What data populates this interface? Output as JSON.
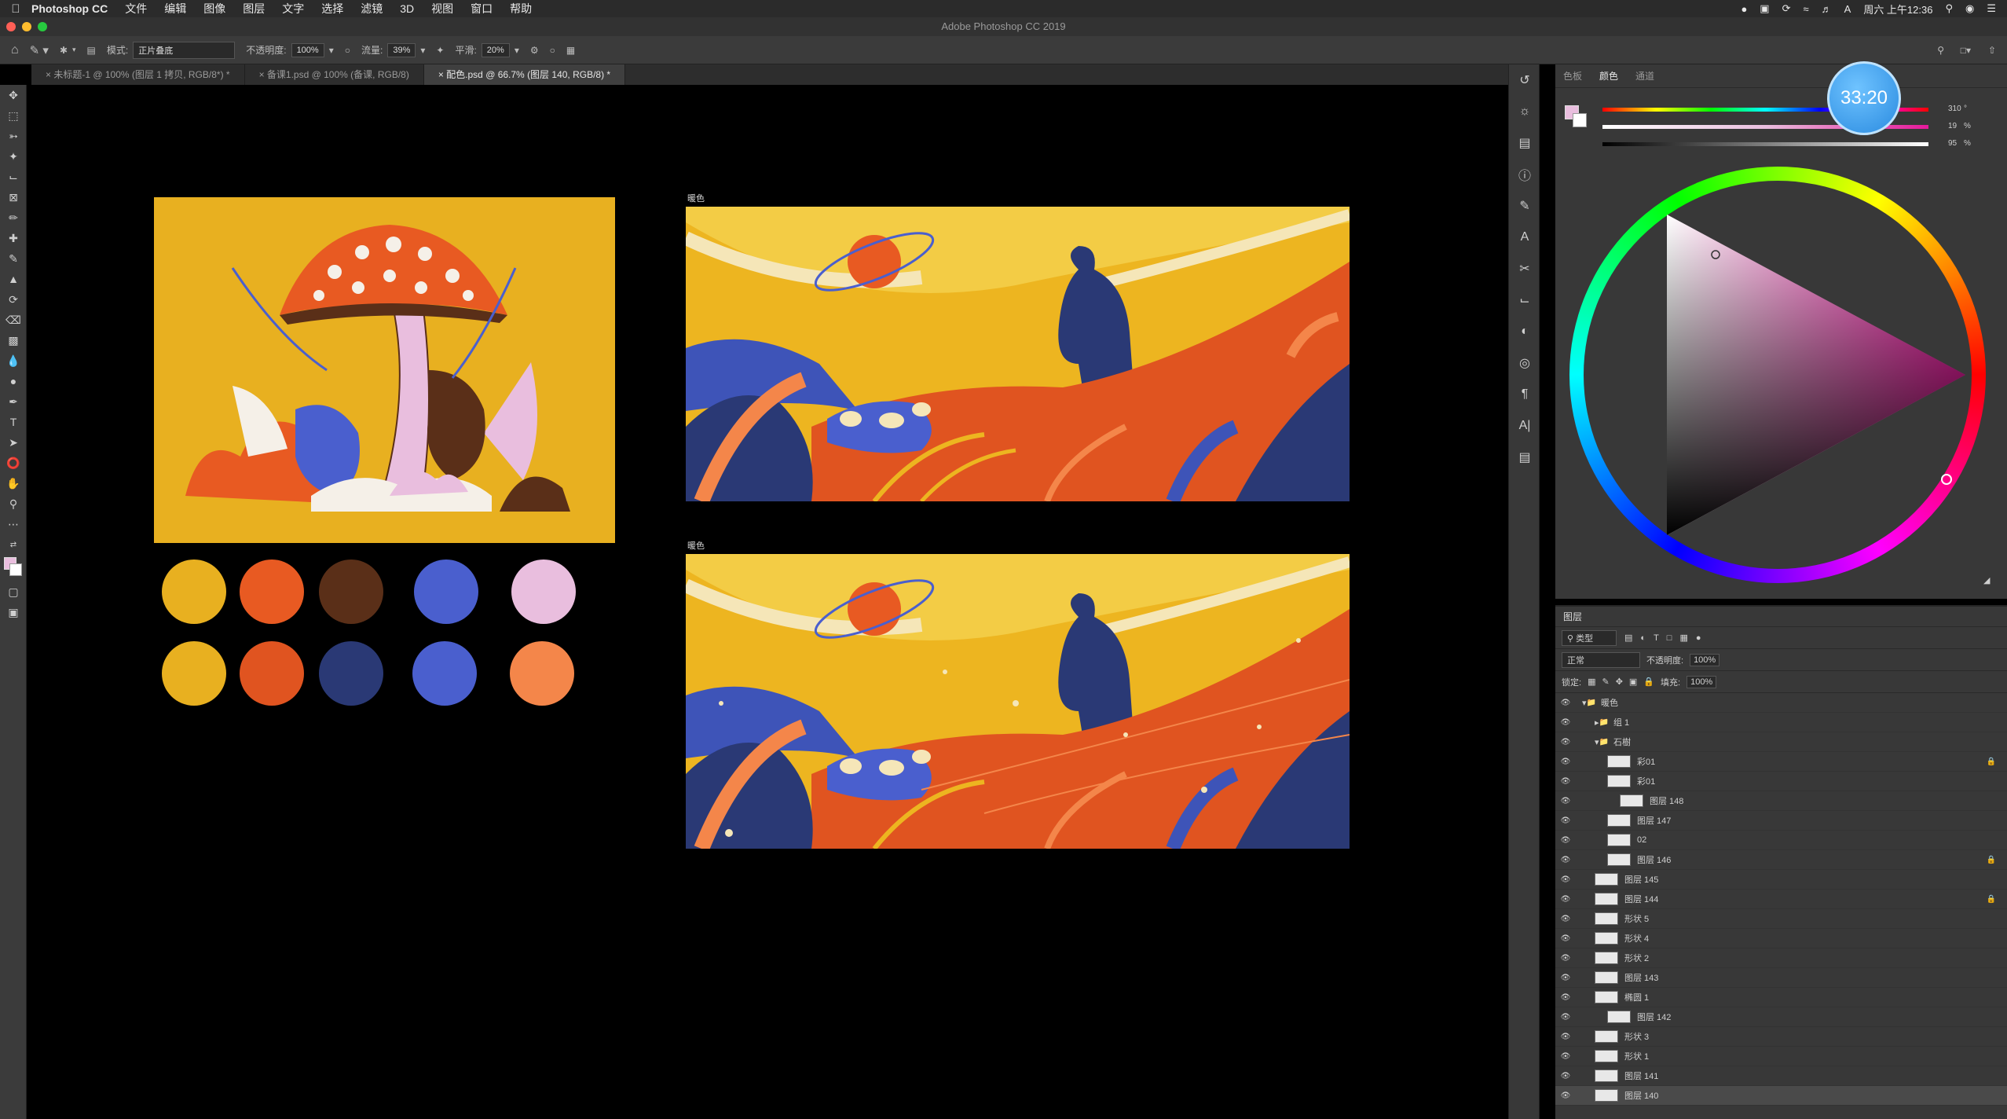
{
  "menubar": {
    "app_name": "Photoshop CC",
    "items": [
      "文件",
      "编辑",
      "图像",
      "图层",
      "文字",
      "选择",
      "滤镜",
      "3D",
      "视图",
      "窗口",
      "帮助"
    ],
    "clock": "周六 上午12:36"
  },
  "window": {
    "title": "Adobe Photoshop CC 2019"
  },
  "options": {
    "mode_label": "模式:",
    "mode_value": "正片叠底",
    "opacity_label": "不透明度:",
    "opacity_value": "100%",
    "flow_label": "流量:",
    "flow_value": "39%",
    "smooth_label": "平滑:",
    "smooth_value": "20%"
  },
  "tabs": [
    {
      "label": "未标题-1 @ 100% (图层 1 拷贝, RGB/8*) *"
    },
    {
      "label": "备课1.psd @ 100% (备课, RGB/8)"
    },
    {
      "label": "配色.psd @ 66.7% (图层 140, RGB/8) *"
    }
  ],
  "canvas": {
    "art1_label": "暖色",
    "art2_label": "暖色",
    "palette": [
      "#E8B020",
      "#E85A22",
      "#5A2F18",
      "#4A5FCE",
      "#E9BEDE",
      "#E8B020",
      "#E05420",
      "#2A3975",
      "#4A5FCE",
      "#F4864A"
    ]
  },
  "color_panel": {
    "tabs": [
      "色板",
      "颜色",
      "通道"
    ],
    "timer": "33:20",
    "values": [
      "310",
      "19",
      "95"
    ],
    "units": [
      "°",
      "%",
      "%"
    ]
  },
  "layers_panel": {
    "title": "图层",
    "filter_label": "类型",
    "blend_mode": "正常",
    "opacity_label": "不透明度:",
    "opacity_value": "100%",
    "lock_label": "锁定:",
    "fill_label": "填充:",
    "fill_value": "100%",
    "layers": [
      {
        "name": "暖色",
        "indent": 0,
        "type": "group-open"
      },
      {
        "name": "组 1",
        "indent": 1,
        "type": "group-closed"
      },
      {
        "name": "石樹",
        "indent": 1,
        "type": "group-open"
      },
      {
        "name": "彩01",
        "indent": 2,
        "type": "layer",
        "lock": true
      },
      {
        "name": "彩01",
        "indent": 2,
        "type": "layer"
      },
      {
        "name": "图层 148",
        "indent": 3,
        "type": "layer"
      },
      {
        "name": "图层 147",
        "indent": 2,
        "type": "layer"
      },
      {
        "name": "02",
        "indent": 2,
        "type": "layer"
      },
      {
        "name": "图层 146",
        "indent": 2,
        "type": "layer",
        "lock": true
      },
      {
        "name": "图层 145",
        "indent": 1,
        "type": "layer"
      },
      {
        "name": "图层 144",
        "indent": 1,
        "type": "layer",
        "lock": true
      },
      {
        "name": "形状 5",
        "indent": 1,
        "type": "layer"
      },
      {
        "name": "形状 4",
        "indent": 1,
        "type": "layer"
      },
      {
        "name": "形状 2",
        "indent": 1,
        "type": "layer"
      },
      {
        "name": "图层 143",
        "indent": 1,
        "type": "layer"
      },
      {
        "name": "椭圆 1",
        "indent": 1,
        "type": "layer"
      },
      {
        "name": "图层 142",
        "indent": 2,
        "type": "layer"
      },
      {
        "name": "形状 3",
        "indent": 1,
        "type": "layer"
      },
      {
        "name": "形状 1",
        "indent": 1,
        "type": "layer"
      },
      {
        "name": "图层 141",
        "indent": 1,
        "type": "layer"
      },
      {
        "name": "图层 140",
        "indent": 1,
        "type": "layer",
        "selected": true
      }
    ]
  }
}
